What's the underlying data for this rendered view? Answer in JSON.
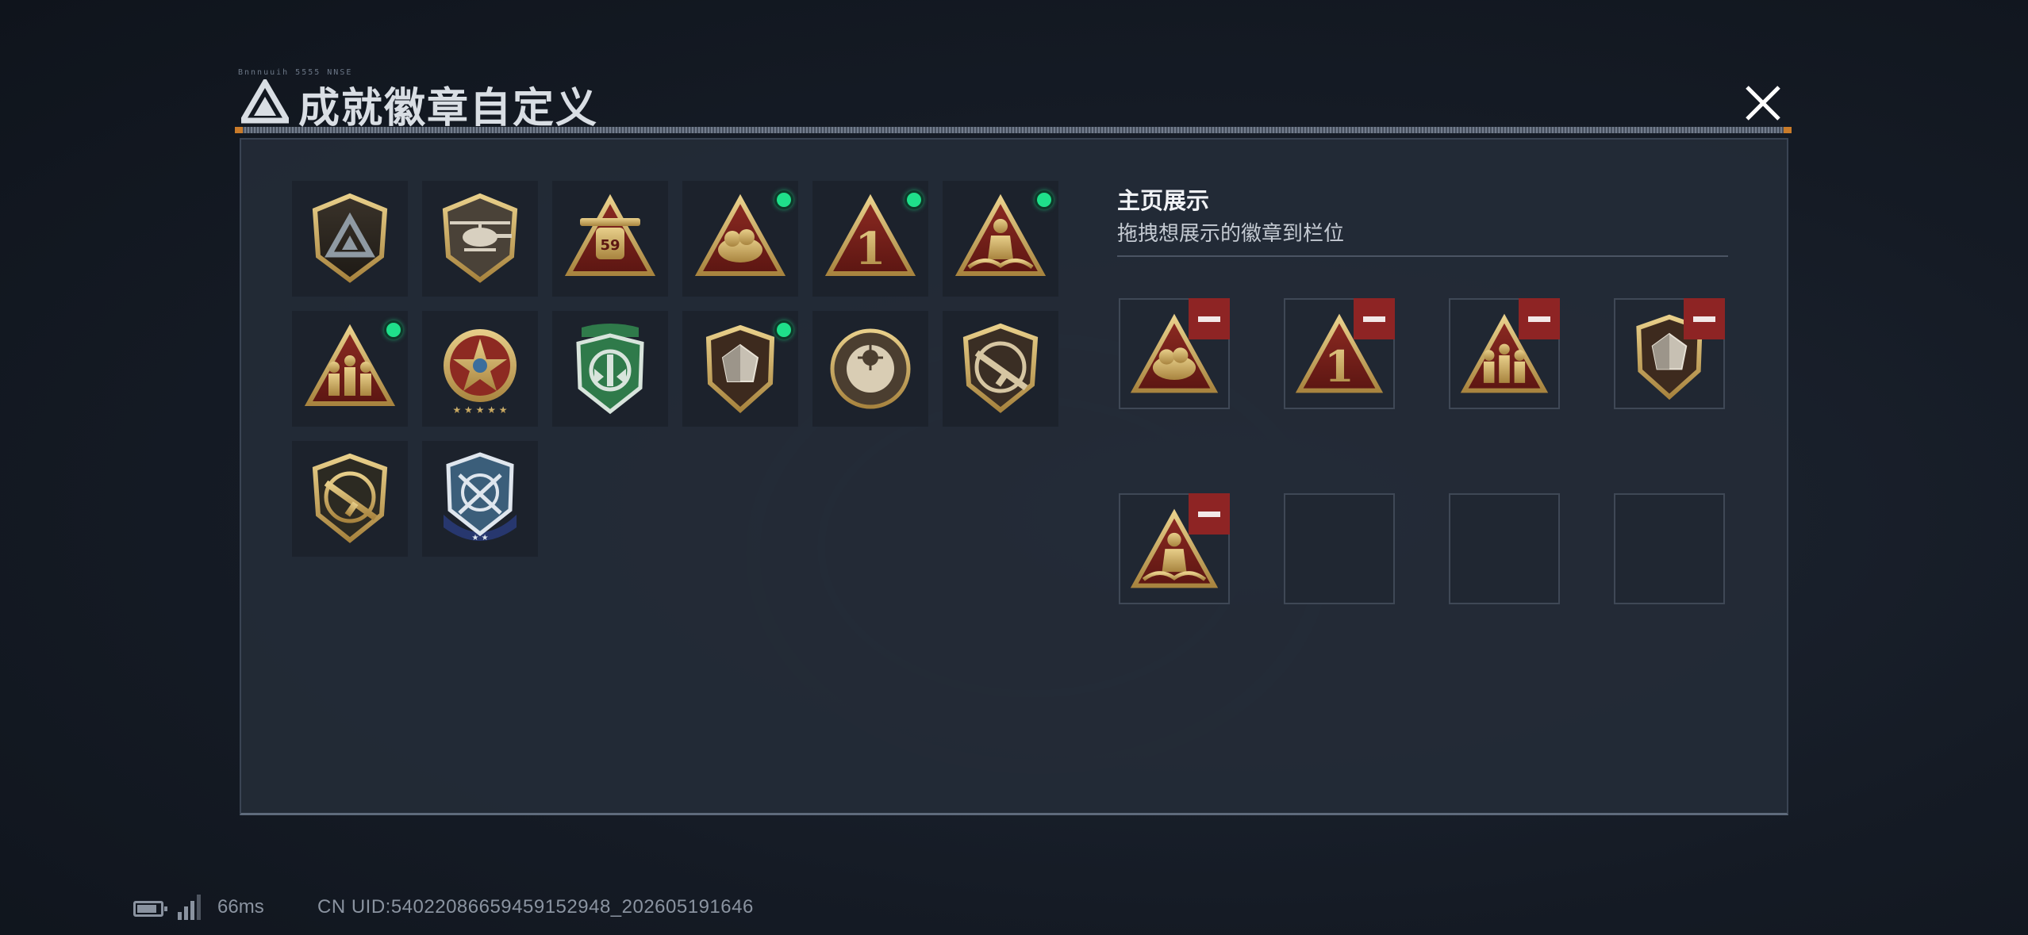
{
  "title": {
    "small_caption": "Bnnnuuih 5555 NNSE",
    "text": "成就徽章自定义"
  },
  "icons": {
    "title_logo": "delta-triangle-logo-icon",
    "close": "close-icon"
  },
  "showcase": {
    "heading": "主页展示",
    "subtitle": "拖拽想展示的徽章到栏位",
    "slots": [
      {
        "badge": "hand-chest-triangle-badge",
        "filled": true
      },
      {
        "badge": "number-one-triangle-badge",
        "filled": true
      },
      {
        "badge": "soldiers-triangle-badge",
        "filled": true
      },
      {
        "badge": "gem-shield-badge",
        "filled": true
      },
      {
        "badge": "kneeling-figure-triangle-badge",
        "filled": true
      },
      {
        "badge": "",
        "filled": false
      },
      {
        "badge": "",
        "filled": false
      },
      {
        "badge": "",
        "filled": false
      }
    ]
  },
  "badges": [
    {
      "name": "delta-shield-badge",
      "new": false
    },
    {
      "name": "helicopter-shield-badge",
      "new": false
    },
    {
      "name": "tank-59-triangle-badge",
      "new": false,
      "label": "59"
    },
    {
      "name": "hand-chest-triangle-badge",
      "new": true
    },
    {
      "name": "number-one-triangle-badge",
      "new": true,
      "label": "1"
    },
    {
      "name": "kneeling-figure-triangle-badge",
      "new": true
    },
    {
      "name": "soldiers-triangle-badge",
      "new": true
    },
    {
      "name": "star-medal-badge",
      "new": false
    },
    {
      "name": "green-wing-shield-badge",
      "new": false
    },
    {
      "name": "gem-shield-badge",
      "new": true
    },
    {
      "name": "crosshair-shield-badge",
      "new": false
    },
    {
      "name": "rifle-shield-badge",
      "new": false
    },
    {
      "name": "rifle-shield-gold-badge",
      "new": false
    },
    {
      "name": "crossed-blades-blue-badge",
      "new": false
    }
  ],
  "status_bar": {
    "ping": "66ms",
    "uid": "CN UID:540220866594591529​48_202605191646"
  },
  "colors": {
    "new_dot": "#1fe08a",
    "remove_button": "#8e2424",
    "badge_gold": "#c9a55a",
    "badge_red": "#7a1f1f"
  }
}
